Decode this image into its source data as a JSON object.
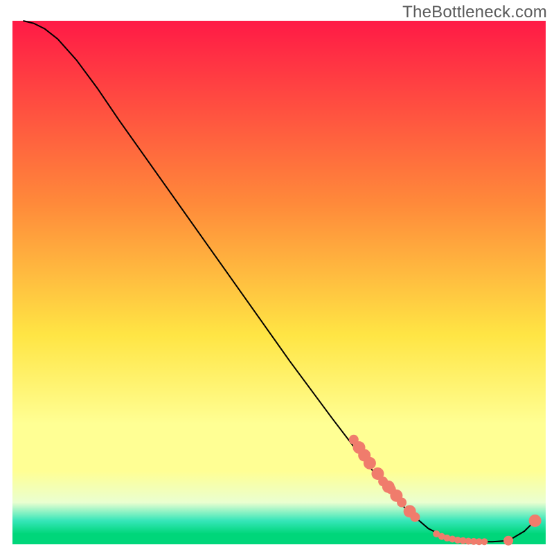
{
  "watermark": "TheBottleneck.com",
  "colors": {
    "line": "#000000",
    "marker": "#f07c6c",
    "gradient_top": "#ff1a46",
    "gradient_mid_orange": "#ff8a3a",
    "gradient_yellow": "#ffe544",
    "gradient_light_yellow": "#ffff94",
    "gradient_pale": "#eaffd0",
    "gradient_cyan": "#36e6b9",
    "gradient_green": "#00d67a"
  },
  "chart_data": {
    "type": "line",
    "xlim": [
      0,
      100
    ],
    "ylim": [
      0,
      100
    ],
    "title": "",
    "xlabel": "",
    "ylabel": "",
    "gradient_stops": [
      {
        "offset": 0.0,
        "key": "gradient_top"
      },
      {
        "offset": 0.35,
        "key": "gradient_mid_orange"
      },
      {
        "offset": 0.6,
        "key": "gradient_yellow"
      },
      {
        "offset": 0.77,
        "key": "gradient_light_yellow"
      },
      {
        "offset": 0.86,
        "key": "gradient_light_yellow"
      },
      {
        "offset": 0.92,
        "key": "gradient_pale"
      },
      {
        "offset": 0.955,
        "key": "gradient_cyan"
      },
      {
        "offset": 0.98,
        "key": "gradient_green"
      },
      {
        "offset": 1.0,
        "key": "gradient_green"
      }
    ],
    "curve": [
      {
        "x": 2.0,
        "y": 100.0
      },
      {
        "x": 4.0,
        "y": 99.5
      },
      {
        "x": 6.0,
        "y": 98.5
      },
      {
        "x": 8.5,
        "y": 96.5
      },
      {
        "x": 12.0,
        "y": 92.5
      },
      {
        "x": 16.0,
        "y": 87.0
      },
      {
        "x": 20.0,
        "y": 81.0
      },
      {
        "x": 28.0,
        "y": 69.5
      },
      {
        "x": 36.0,
        "y": 58.0
      },
      {
        "x": 44.0,
        "y": 46.5
      },
      {
        "x": 52.0,
        "y": 35.0
      },
      {
        "x": 60.0,
        "y": 24.0
      },
      {
        "x": 66.0,
        "y": 16.0
      },
      {
        "x": 70.0,
        "y": 11.0
      },
      {
        "x": 74.0,
        "y": 6.5
      },
      {
        "x": 78.0,
        "y": 3.0
      },
      {
        "x": 82.0,
        "y": 1.0
      },
      {
        "x": 86.0,
        "y": 0.5
      },
      {
        "x": 90.0,
        "y": 0.5
      },
      {
        "x": 93.0,
        "y": 0.7
      },
      {
        "x": 96.0,
        "y": 2.5
      },
      {
        "x": 98.0,
        "y": 4.5
      }
    ],
    "markers_large": [
      {
        "x": 65.0,
        "y": 18.5
      },
      {
        "x": 66.0,
        "y": 17.0
      },
      {
        "x": 67.0,
        "y": 15.5
      },
      {
        "x": 68.5,
        "y": 13.5
      },
      {
        "x": 70.5,
        "y": 11.0
      },
      {
        "x": 72.0,
        "y": 9.3
      },
      {
        "x": 74.5,
        "y": 6.3
      },
      {
        "x": 98.0,
        "y": 4.5
      }
    ],
    "markers_medium": [
      {
        "x": 64.0,
        "y": 20.0
      },
      {
        "x": 69.5,
        "y": 12.0
      },
      {
        "x": 71.0,
        "y": 10.5
      },
      {
        "x": 73.0,
        "y": 8.0
      },
      {
        "x": 75.5,
        "y": 5.2
      },
      {
        "x": 93.0,
        "y": 0.7
      }
    ],
    "markers_small": [
      {
        "x": 79.5,
        "y": 2.0
      },
      {
        "x": 80.5,
        "y": 1.5
      },
      {
        "x": 81.5,
        "y": 1.2
      },
      {
        "x": 82.5,
        "y": 1.0
      },
      {
        "x": 83.5,
        "y": 0.8
      },
      {
        "x": 84.5,
        "y": 0.7
      },
      {
        "x": 85.5,
        "y": 0.6
      },
      {
        "x": 86.5,
        "y": 0.55
      },
      {
        "x": 87.5,
        "y": 0.5
      },
      {
        "x": 88.5,
        "y": 0.5
      }
    ]
  }
}
